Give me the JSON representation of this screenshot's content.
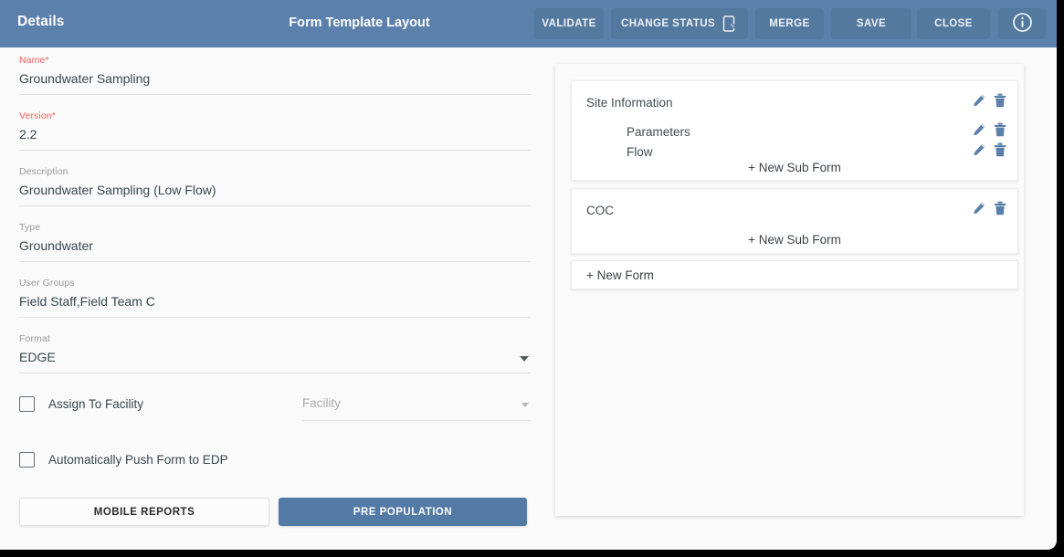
{
  "header": {
    "left_title": "Details",
    "center_title": "Form Template Layout",
    "buttons": [
      {
        "label": "VALIDATE",
        "name": "validate-button"
      },
      {
        "label": "CHANGE STATUS",
        "name": "change-status-button",
        "icon": "tap-device-icon"
      },
      {
        "label": "MERGE",
        "name": "merge-button"
      },
      {
        "label": "SAVE",
        "name": "save-button"
      },
      {
        "label": "CLOSE",
        "name": "close-button"
      }
    ],
    "info_icon": "info-circle-icon",
    "bar_color": "#5b80ac",
    "button_color": "#54799f"
  },
  "details_form": {
    "fields": [
      {
        "label": "Name",
        "required": true,
        "value": "Groundwater Sampling",
        "type": "text"
      },
      {
        "label": "Version",
        "required": true,
        "value": "2.2",
        "type": "text"
      },
      {
        "label": "Description",
        "required": false,
        "value": "Groundwater Sampling (Low Flow)",
        "type": "text"
      },
      {
        "label": "Type",
        "required": false,
        "value": "Groundwater",
        "type": "text"
      },
      {
        "label": "User Groups",
        "required": false,
        "value": "Field Staff,Field Team C",
        "type": "text"
      },
      {
        "label": "Format",
        "required": false,
        "value": "EDGE",
        "type": "select"
      }
    ],
    "required_marker": "*",
    "checkboxes": [
      {
        "label": "Assign To Facility",
        "checked": false
      },
      {
        "label": "Automatically Push Form to EDP",
        "checked": false
      }
    ],
    "facility_select": {
      "placeholder": "Facility",
      "value": ""
    },
    "buttons": {
      "mobile_reports": "MOBILE REPORTS",
      "pre_population": "PRE POPULATION"
    },
    "required_label_color": "#f4615f",
    "primary_button_color": "#527aa5"
  },
  "layout_panel": {
    "forms": [
      {
        "name": "Site Information",
        "sub_forms": [
          "Parameters",
          "Flow"
        ],
        "new_sub_form_label": "+ New Sub Form"
      },
      {
        "name": "COC",
        "sub_forms": [],
        "new_sub_form_label": "+ New Sub Form"
      }
    ],
    "new_form_label": "+ New Form",
    "row_actions": {
      "edit": "pencil-icon",
      "delete": "trash-icon"
    },
    "icon_color": "#5b7fa8"
  }
}
